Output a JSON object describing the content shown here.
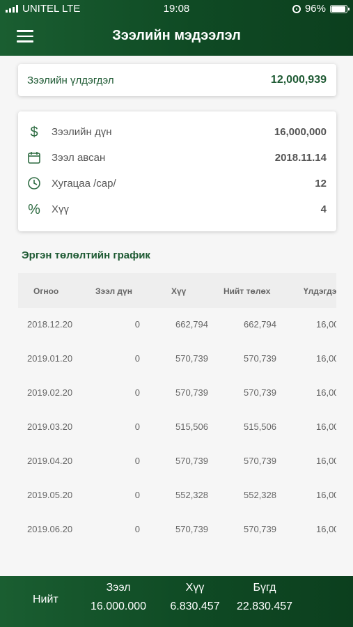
{
  "status_bar": {
    "carrier": "UNITEL LTE",
    "time": "19:08",
    "battery": "96%"
  },
  "header": {
    "title": "Зээлийн мэдээлэл"
  },
  "balance": {
    "label": "Зээлийн үлдэгдэл",
    "value": "12,000,939"
  },
  "info": [
    {
      "icon": "dollar-icon",
      "label": "Зээлийн дүн",
      "value": "16,000,000"
    },
    {
      "icon": "calendar-icon",
      "label": "Зээл авсан",
      "value": "2018.11.14"
    },
    {
      "icon": "clock-icon",
      "label": "Хугацаа /сар/",
      "value": "12"
    },
    {
      "icon": "percent-icon",
      "label": "Хүү",
      "value": "4"
    }
  ],
  "schedule": {
    "title": "Эргэн төлөлтийн график",
    "columns": [
      "Огноо",
      "Зээл дүн",
      "Хүү",
      "Нийт төлөх",
      "Үлдэгдэ"
    ],
    "rows": [
      [
        "2018.12.20",
        "0",
        "662,794",
        "662,794",
        "16,00"
      ],
      [
        "2019.01.20",
        "0",
        "570,739",
        "570,739",
        "16,00"
      ],
      [
        "2019.02.20",
        "0",
        "570,739",
        "570,739",
        "16,00"
      ],
      [
        "2019.03.20",
        "0",
        "515,506",
        "515,506",
        "16,00"
      ],
      [
        "2019.04.20",
        "0",
        "570,739",
        "570,739",
        "16,00"
      ],
      [
        "2019.05.20",
        "0",
        "552,328",
        "552,328",
        "16,00"
      ],
      [
        "2019.06.20",
        "0",
        "570,739",
        "570,739",
        "16,00"
      ]
    ]
  },
  "footer": {
    "total_label": "Нийт",
    "loan": {
      "label": "Зээл",
      "value": "16.000.000"
    },
    "interest": {
      "label": "Хүү",
      "value": "6.830.457"
    },
    "sum": {
      "label": "Бүгд",
      "value": "22.830.457"
    }
  },
  "colors": {
    "brand": "#1a5e31",
    "accent_text": "#1e5a33"
  }
}
